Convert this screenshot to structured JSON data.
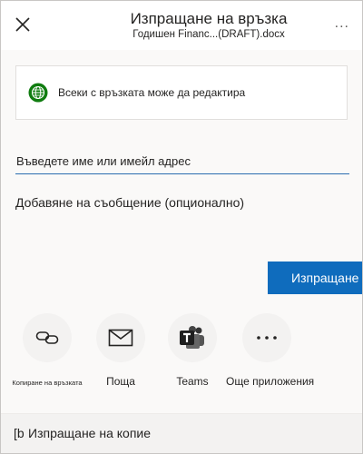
{
  "header": {
    "title": "Изпращане на връзка",
    "file_name": "Годишен Financ...(DRAFT).docx",
    "close_icon": "close-icon",
    "more_icon": "more-options-icon",
    "more_label": "..."
  },
  "link_settings": {
    "text": "Всеки с връзката може да редактира",
    "icon": "globe-icon",
    "icon_color": "#107c10"
  },
  "recipient": {
    "placeholder": "Въведете име или имейл адрес"
  },
  "message": {
    "placeholder": "Добавяне на съобщение (опционално)"
  },
  "send_button": {
    "label": "Изпращане",
    "color": "#0f6cbd"
  },
  "share_options": [
    {
      "label": "Копиране на връзката",
      "icon": "link-icon"
    },
    {
      "label": "Поща",
      "icon": "mail-icon"
    },
    {
      "label": "Teams",
      "icon": "teams-icon",
      "icon_color": "#4b53bc"
    },
    {
      "label": "Още приложения",
      "icon": "more-apps-icon"
    }
  ],
  "footer": {
    "icon_glyph": "[b",
    "label": "Изпращане на копие"
  }
}
